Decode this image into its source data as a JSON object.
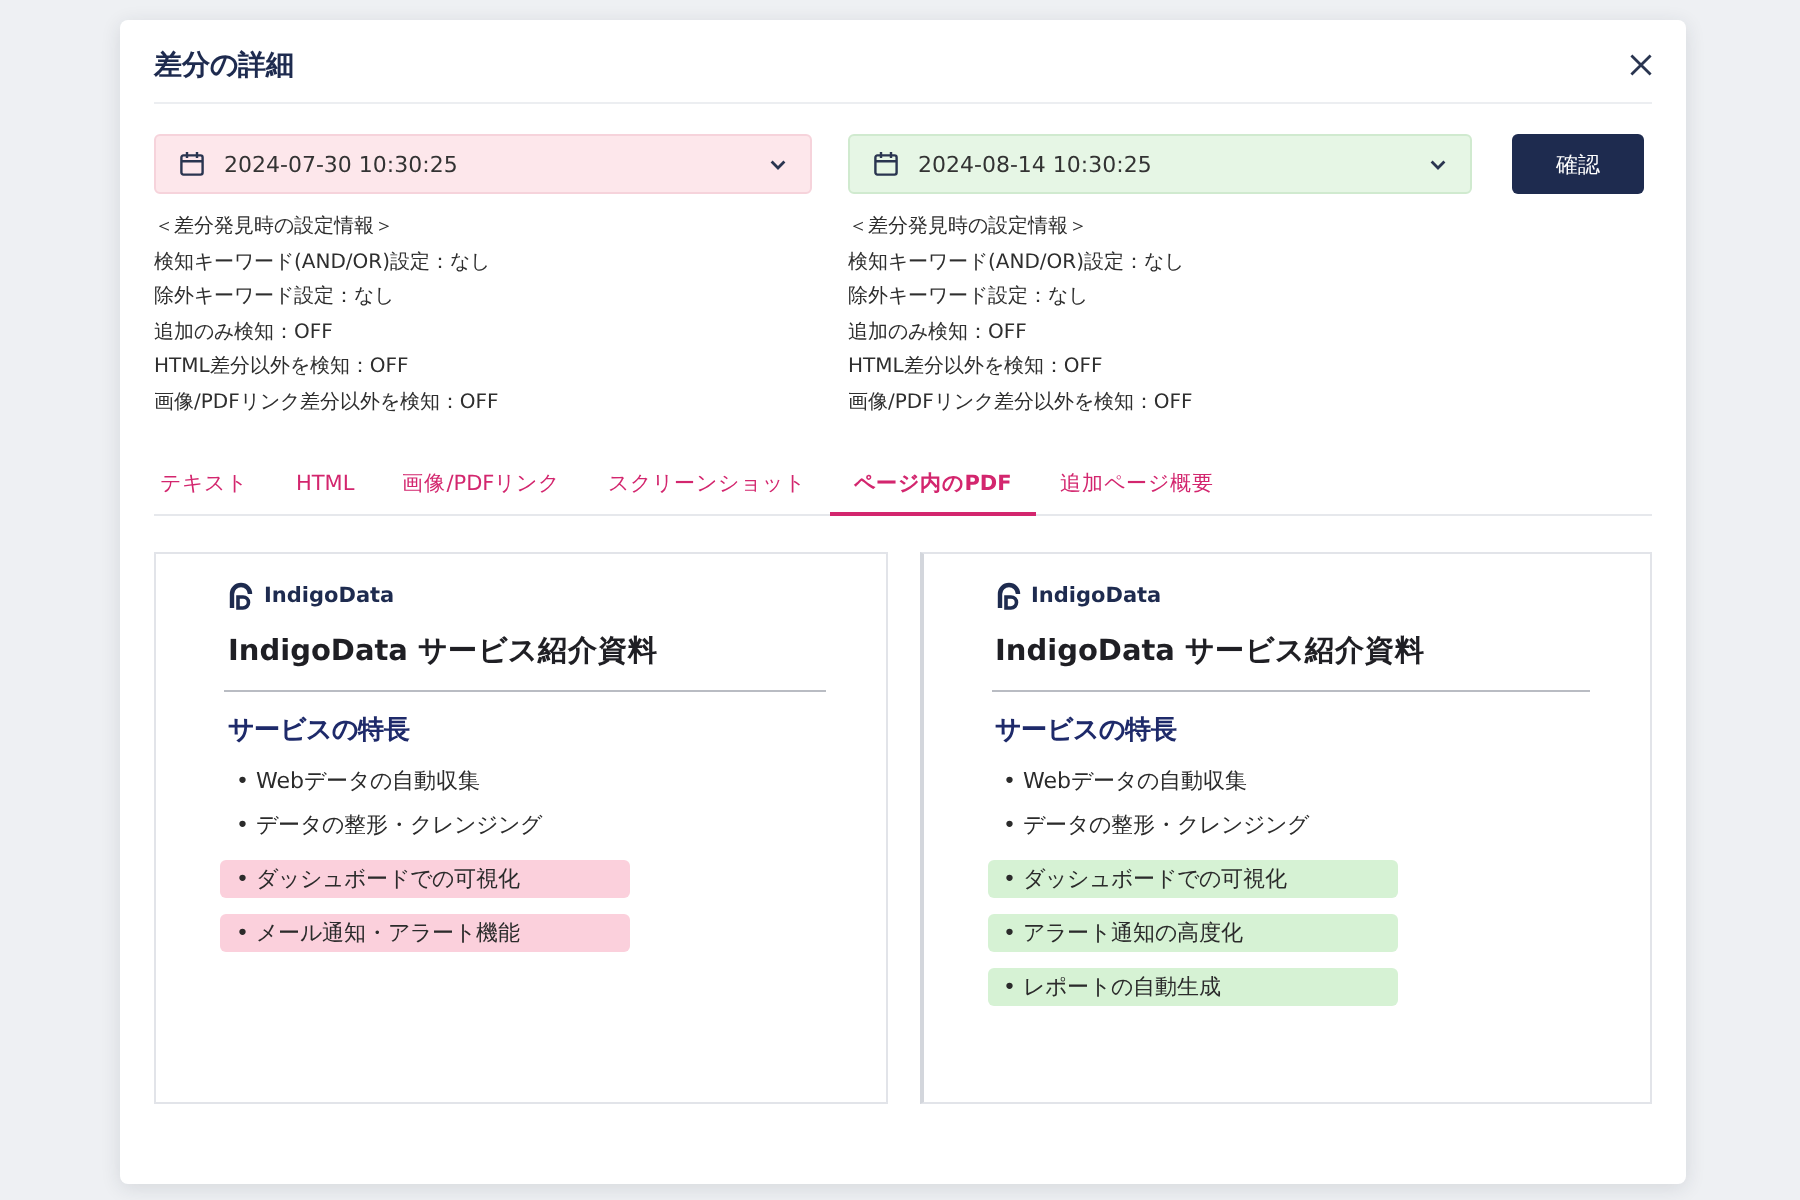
{
  "dialog": {
    "title": "差分の詳細"
  },
  "comparison": [
    {
      "kind": "old",
      "date": "2024-07-30 10:30:25",
      "settings_heading": "＜差分発見時の設定情報＞",
      "settings": [
        "検知キーワード(AND/OR)設定：なし",
        "除外キーワード設定：なし",
        "追加のみ検知：OFF",
        "HTML差分以外を検知：OFF",
        "画像/PDFリンク差分以外を検知：OFF"
      ]
    },
    {
      "kind": "new",
      "date": "2024-08-14 10:30:25",
      "settings_heading": "＜差分発見時の設定情報＞",
      "settings": [
        "検知キーワード(AND/OR)設定：なし",
        "除外キーワード設定：なし",
        "追加のみ検知：OFF",
        "HTML差分以外を検知：OFF",
        "画像/PDFリンク差分以外を検知：OFF"
      ]
    }
  ],
  "confirm_button": "確認",
  "tabs": [
    {
      "label": "テキスト",
      "selected": false
    },
    {
      "label": "HTML",
      "selected": false
    },
    {
      "label": "画像/PDFリンク",
      "selected": false
    },
    {
      "label": "スクリーンショット",
      "selected": false
    },
    {
      "label": "ページ内のPDF",
      "selected": true
    },
    {
      "label": "追加ページ概要",
      "selected": false
    }
  ],
  "panes": [
    {
      "kind": "old",
      "logo_text": "IndigoData",
      "title": "IndigoData サービス紹介資料",
      "section_heading": "サービスの特長",
      "items": [
        {
          "text": "• Webデータの自動収集",
          "changed": false
        },
        {
          "text": "• データの整形・クレンジング",
          "changed": false
        },
        {
          "text": "• ダッシュボードでの可視化",
          "changed": true
        },
        {
          "text": "• メール通知・アラート機能",
          "changed": true
        }
      ]
    },
    {
      "kind": "new",
      "logo_text": "IndigoData",
      "title": "IndigoData サービス紹介資料",
      "section_heading": "サービスの特長",
      "items": [
        {
          "text": "• Webデータの自動収集",
          "changed": false
        },
        {
          "text": "• データの整形・クレンジング",
          "changed": false
        },
        {
          "text": "• ダッシュボードでの可視化",
          "changed": true
        },
        {
          "text": "• アラート通知の高度化",
          "changed": true
        },
        {
          "text": "• レポートの自動生成",
          "changed": true
        }
      ]
    }
  ]
}
